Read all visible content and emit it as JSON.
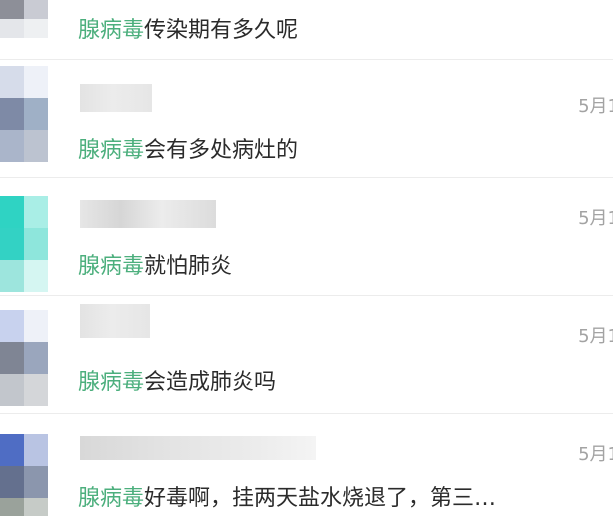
{
  "keyword": "腺病毒",
  "messages": [
    {
      "date": "",
      "text": "传染期有多久呢"
    },
    {
      "date": "5月1",
      "text": "会有多处病灶的"
    },
    {
      "date": "5月1",
      "text": "就怕肺炎"
    },
    {
      "date": "5月1",
      "text": "会造成肺炎吗"
    },
    {
      "date": "5月1",
      "text": "好毒啊，挂两天盐水烧退了，第三…"
    }
  ],
  "colors": {
    "keyword": "#4caf7d",
    "text": "#2b2b2b",
    "date": "#a3a3a3",
    "divider": "#ececec"
  }
}
